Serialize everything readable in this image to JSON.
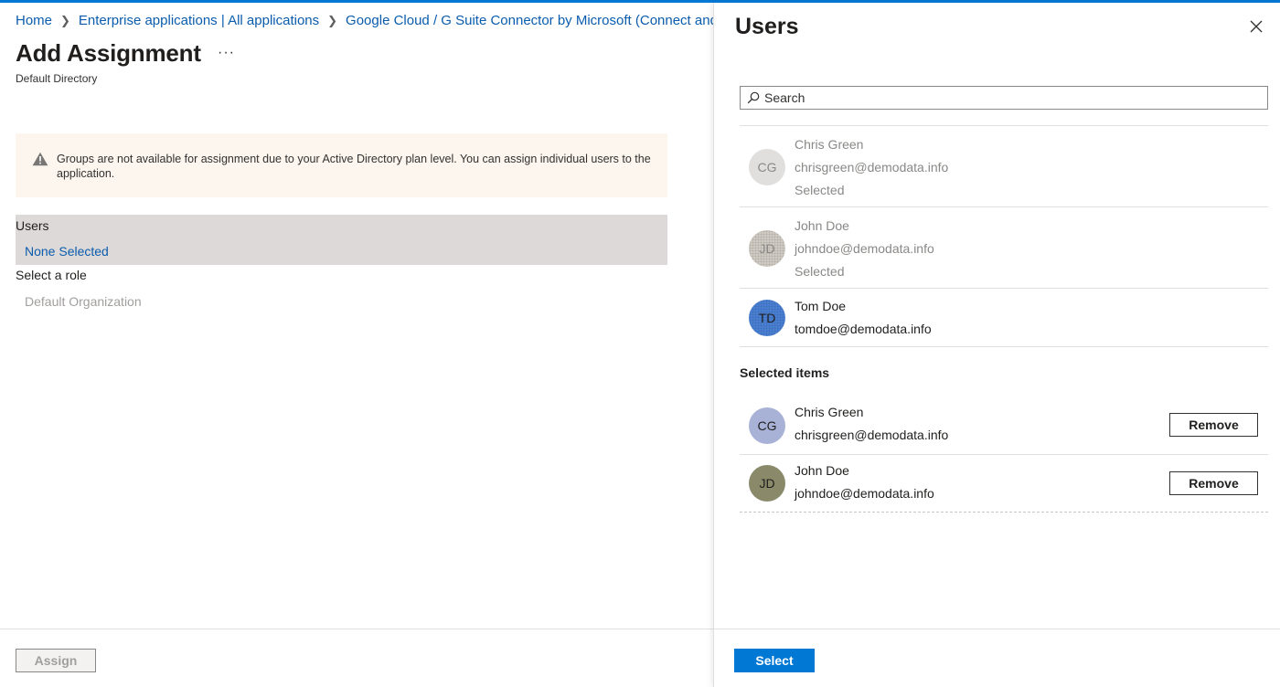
{
  "breadcrumb": {
    "items": [
      "Home",
      "Enterprise applications | All applications",
      "Google Cloud / G Suite Connector by Microsoft (Connect and"
    ]
  },
  "page": {
    "title": "Add Assignment",
    "more": "···",
    "subtitle": "Default Directory"
  },
  "warning": {
    "text": "Groups are not available for assignment due to your Active Directory plan level. You can assign individual users to the application."
  },
  "users_section": {
    "label": "Users",
    "value": "None Selected"
  },
  "role_section": {
    "label": "Select a role",
    "value": "Default Organization"
  },
  "footer": {
    "assign_label": "Assign"
  },
  "panel": {
    "title": "Users",
    "search_placeholder": "Search",
    "results": [
      {
        "initials": "CG",
        "name": "Chris Green",
        "email": "chrisgreen@demodata.info",
        "status": "Selected"
      },
      {
        "initials": "JD",
        "name": "John Doe",
        "email": "johndoe@demodata.info",
        "status": "Selected"
      },
      {
        "initials": "TD",
        "name": "Tom Doe",
        "email": "tomdoe@demodata.info",
        "status": ""
      }
    ],
    "selected_heading": "Selected items",
    "selected_items": [
      {
        "initials": "CG",
        "name": "Chris Green",
        "email": "chrisgreen@demodata.info",
        "remove_label": "Remove"
      },
      {
        "initials": "JD",
        "name": "John Doe",
        "email": "johndoe@demodata.info",
        "remove_label": "Remove"
      }
    ],
    "select_label": "Select"
  },
  "colors": {
    "accent": "#0078d4",
    "link": "#0b5cad",
    "warning_bg": "#fdf6ee",
    "users_block_bg": "#ddd9d8",
    "avatar_cg": "#a8b2d6",
    "avatar_jd": "#8a8a6a",
    "avatar_td": "#4a7fd0"
  }
}
